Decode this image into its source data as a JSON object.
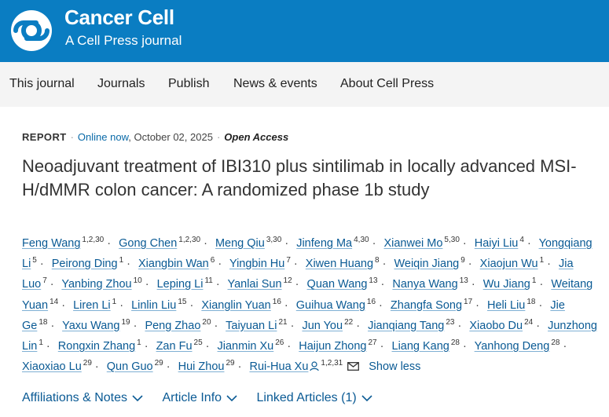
{
  "header": {
    "brand_title": "Cancer Cell",
    "brand_subtitle": "A Cell Press journal",
    "logo_icon": "cell-press-logo-icon",
    "bg_color": "#0a7dc2"
  },
  "nav": {
    "items": [
      "This journal",
      "Journals",
      "Publish",
      "News & events",
      "About Cell Press"
    ]
  },
  "article": {
    "type": "REPORT",
    "online_label": "Online now",
    "date": ", October 02, 2025",
    "access": "Open Access",
    "title": "Neoadjuvant treatment of IBI310 plus sintilimab in locally advanced MSI-H/dMMR colon cancer: A randomized phase 1b study"
  },
  "authors": [
    {
      "name": "Feng Wang",
      "aff": "1,2,30"
    },
    {
      "name": "Gong Chen",
      "aff": "1,2,30"
    },
    {
      "name": "Meng Qiu",
      "aff": "3,30"
    },
    {
      "name": "Jinfeng Ma",
      "aff": "4,30"
    },
    {
      "name": "Xianwei Mo",
      "aff": "5,30"
    },
    {
      "name": "Haiyi Liu",
      "aff": "4"
    },
    {
      "name": "Yongqiang Li",
      "aff": "5"
    },
    {
      "name": "Peirong Ding",
      "aff": "1"
    },
    {
      "name": "Xiangbin Wan",
      "aff": "6"
    },
    {
      "name": "Yingbin Hu",
      "aff": "7"
    },
    {
      "name": "Xiwen Huang",
      "aff": "8"
    },
    {
      "name": "Weiqin Jiang",
      "aff": "9"
    },
    {
      "name": "Xiaojun Wu",
      "aff": "1"
    },
    {
      "name": "Jia Luo",
      "aff": "7"
    },
    {
      "name": "Yanbing Zhou",
      "aff": "10"
    },
    {
      "name": "Leping Li",
      "aff": "11"
    },
    {
      "name": "Yanlai Sun",
      "aff": "12"
    },
    {
      "name": "Quan Wang",
      "aff": "13"
    },
    {
      "name": "Nanya Wang",
      "aff": "13"
    },
    {
      "name": "Wu Jiang",
      "aff": "1"
    },
    {
      "name": "Weitang Yuan",
      "aff": "14"
    },
    {
      "name": "Liren Li",
      "aff": "1"
    },
    {
      "name": "Linlin Liu",
      "aff": "15"
    },
    {
      "name": "Xianglin Yuan",
      "aff": "16"
    },
    {
      "name": "Guihua Wang",
      "aff": "16"
    },
    {
      "name": "Zhangfa Song",
      "aff": "17"
    },
    {
      "name": "Heli Liu",
      "aff": "18"
    },
    {
      "name": "Jie Ge",
      "aff": "18"
    },
    {
      "name": "Yaxu Wang",
      "aff": "19"
    },
    {
      "name": "Peng Zhao",
      "aff": "20"
    },
    {
      "name": "Taiyuan Li",
      "aff": "21"
    },
    {
      "name": "Jun You",
      "aff": "22"
    },
    {
      "name": "Jianqiang Tang",
      "aff": "23"
    },
    {
      "name": "Xiaobo Du",
      "aff": "24"
    },
    {
      "name": "Junzhong Lin",
      "aff": "1"
    },
    {
      "name": "Rongxin Zhang",
      "aff": "1"
    },
    {
      "name": "Zan Fu",
      "aff": "25"
    },
    {
      "name": "Jianmin Xu",
      "aff": "26"
    },
    {
      "name": "Haijun Zhong",
      "aff": "27"
    },
    {
      "name": "Liang Kang",
      "aff": "28"
    },
    {
      "name": "Yanhong Deng",
      "aff": "28"
    },
    {
      "name": "Xiaoxiao Lu",
      "aff": "29"
    },
    {
      "name": "Qun Guo",
      "aff": "29"
    },
    {
      "name": "Hui Zhou",
      "aff": "29"
    },
    {
      "name": "Rui-Hua Xu",
      "aff": "1,2,31",
      "corresponding": true
    }
  ],
  "show_less": "Show less",
  "bottom_links": [
    {
      "label": "Affiliations & Notes"
    },
    {
      "label": "Article Info"
    },
    {
      "label": "Linked Articles (1)"
    }
  ]
}
